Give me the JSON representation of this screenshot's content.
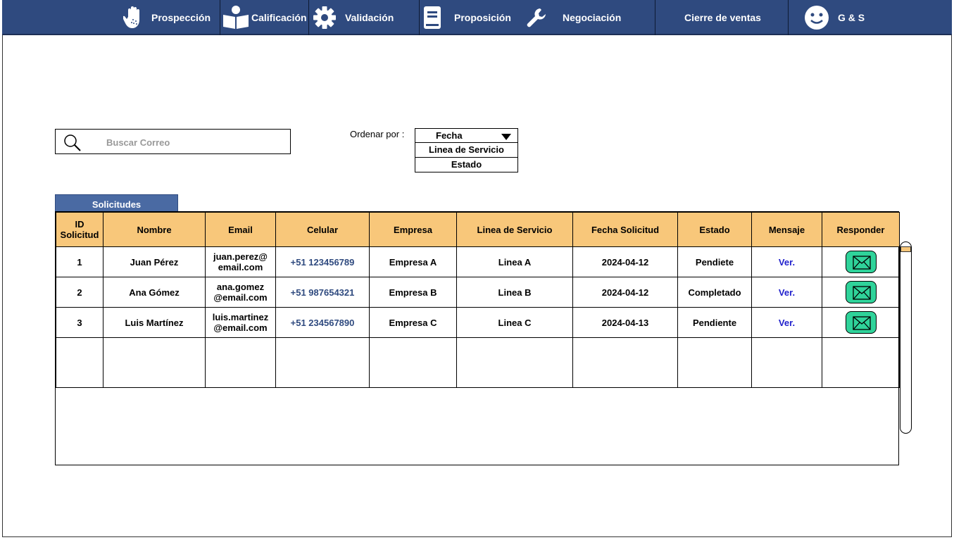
{
  "nav": {
    "items": [
      {
        "label": "Prospección",
        "icon": "hand-icon"
      },
      {
        "label": "Calificación",
        "icon": "reader-icon"
      },
      {
        "label": "Validación",
        "icon": "gear-icon"
      },
      {
        "label": "Proposición",
        "icon": "document-icon"
      },
      {
        "label": "Negociación",
        "icon": "wrench-icon"
      },
      {
        "label": "Cierre de ventas",
        "icon": ""
      },
      {
        "label": "G & S",
        "icon": "smiley-icon"
      }
    ]
  },
  "search": {
    "placeholder": "Buscar Correo"
  },
  "sort": {
    "label": "Ordenar por :",
    "selected": "Fecha",
    "options": [
      "Linea de Servicio",
      "Estado"
    ]
  },
  "tab": {
    "label": "Solicitudes"
  },
  "table": {
    "headers": [
      "ID Solicitud",
      "Nombre",
      "Email",
      "Celular",
      "Empresa",
      "Linea de Servicio",
      "Fecha Solicitud",
      "Estado",
      "Mensaje",
      "Responder"
    ],
    "rows": [
      {
        "id": "1",
        "nombre": "Juan Pérez",
        "email": "juan.perez@ email.com",
        "celular": "+51 123456789",
        "empresa": "Empresa A",
        "linea": "Linea A",
        "fecha": "2024-04-12",
        "estado": "Pendiete",
        "mensaje": "Ver."
      },
      {
        "id": "2",
        "nombre": "Ana Gómez",
        "email": "ana.gomez @email.com",
        "celular": "+51 987654321",
        "empresa": "Empresa B",
        "linea": "Linea B",
        "fecha": "2024-04-12",
        "estado": "Completado",
        "mensaje": "Ver."
      },
      {
        "id": "3",
        "nombre": "Luis Martínez",
        "email": "luis.martinez @email.com",
        "celular": "+51 234567890",
        "empresa": "Empresa C",
        "linea": "Linea C",
        "fecha": "2024-04-13",
        "estado": "Pendiente",
        "mensaje": "Ver."
      }
    ]
  },
  "colors": {
    "nav_bg": "#2f4a7f",
    "header_bg": "#f8c77a",
    "tab_bg": "#4a6aa3",
    "reply_btn": "#2fd39a",
    "link": "#1f1fcc"
  }
}
